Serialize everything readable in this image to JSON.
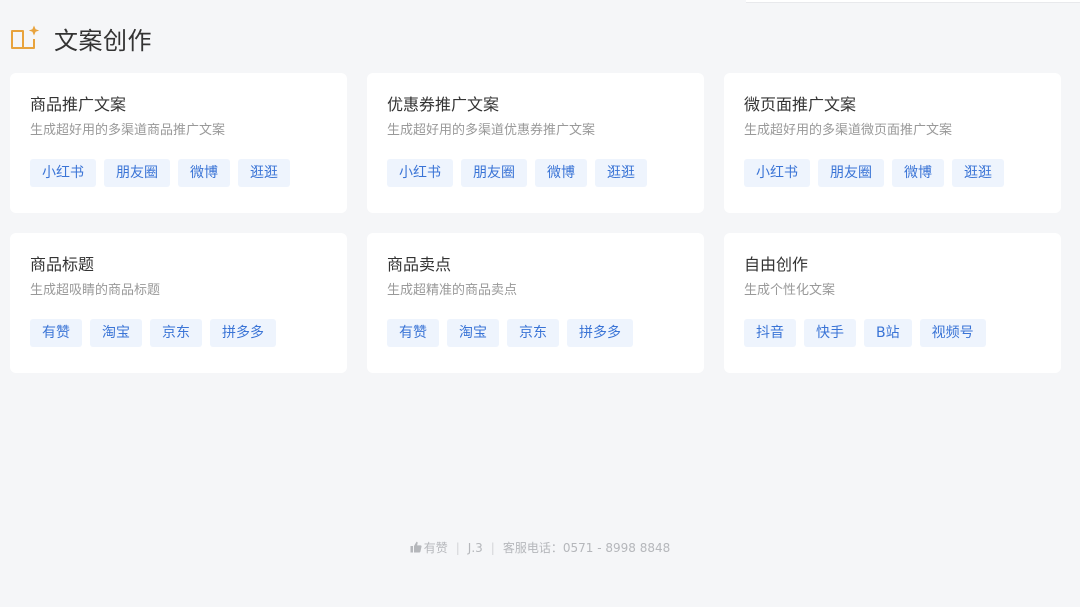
{
  "header": {
    "title": "文案创作",
    "icon": "book-sparkle-icon",
    "accent_color": "#e8a33d"
  },
  "cards": [
    {
      "title": "商品推广文案",
      "desc": "生成超好用的多渠道商品推广文案",
      "tags": [
        "小红书",
        "朋友圈",
        "微博",
        "逛逛"
      ]
    },
    {
      "title": "优惠券推广文案",
      "desc": "生成超好用的多渠道优惠券推广文案",
      "tags": [
        "小红书",
        "朋友圈",
        "微博",
        "逛逛"
      ]
    },
    {
      "title": "微页面推广文案",
      "desc": "生成超好用的多渠道微页面推广文案",
      "tags": [
        "小红书",
        "朋友圈",
        "微博",
        "逛逛"
      ]
    },
    {
      "title": "商品标题",
      "desc": "生成超吸睛的商品标题",
      "tags": [
        "有赞",
        "淘宝",
        "京东",
        "拼多多"
      ]
    },
    {
      "title": "商品卖点",
      "desc": "生成超精准的商品卖点",
      "tags": [
        "有赞",
        "淘宝",
        "京东",
        "拼多多"
      ]
    },
    {
      "title": "自由创作",
      "desc": "生成个性化文案",
      "tags": [
        "抖音",
        "快手",
        "B站",
        "视频号"
      ]
    }
  ],
  "footer": {
    "brand": "有赞",
    "version": "J.3",
    "service": "客服电话：0571 - 8998 8848"
  },
  "colors": {
    "tag_bg": "#eef4fd",
    "tag_text": "#3a74d6",
    "page_bg": "#f5f6f8"
  }
}
